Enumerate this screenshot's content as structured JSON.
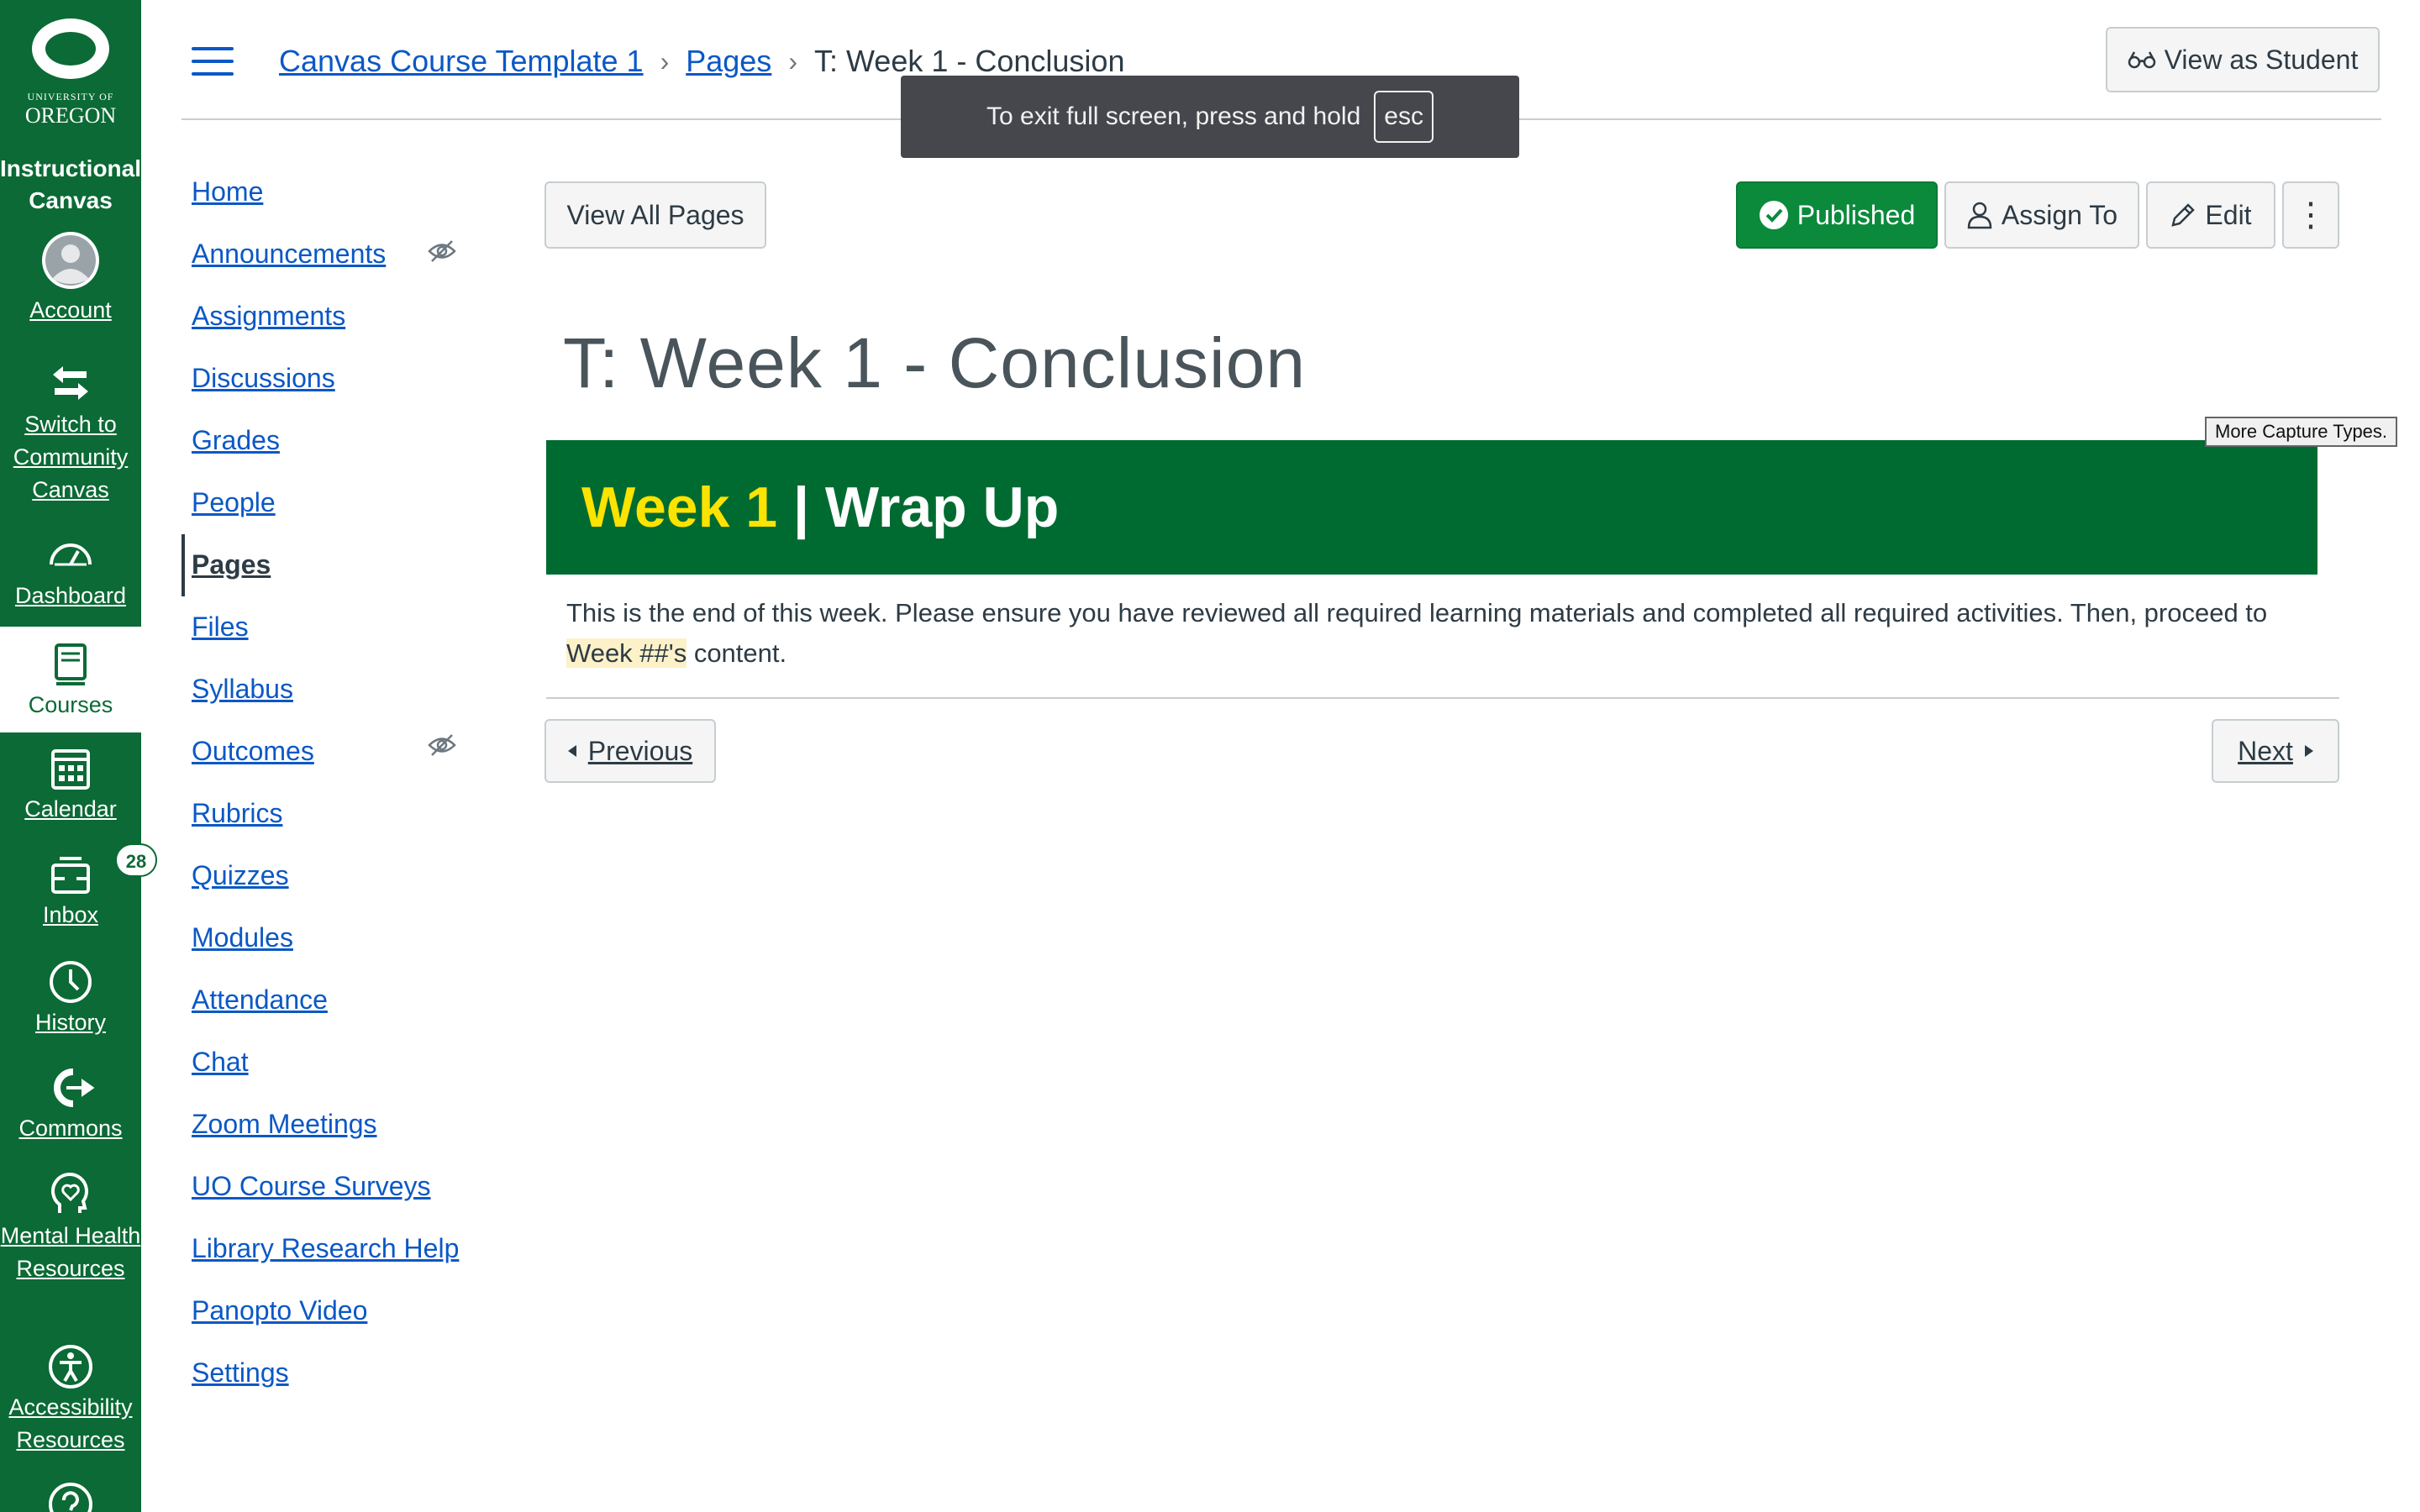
{
  "global_nav": {
    "logo": {
      "small": "UNIVERSITY OF",
      "big": "OREGON"
    },
    "institution": "Instructional Canvas",
    "items": [
      {
        "label": "Account",
        "icon": "avatar-icon"
      },
      {
        "label": "Switch to Community Canvas",
        "icon": "switch-arrows-icon"
      },
      {
        "label": "Dashboard",
        "icon": "dashboard-gauge-icon"
      },
      {
        "label": "Courses",
        "icon": "courses-book-icon",
        "active": true
      },
      {
        "label": "Calendar",
        "icon": "calendar-icon"
      },
      {
        "label": "Inbox",
        "icon": "inbox-icon",
        "badge": "28"
      },
      {
        "label": "History",
        "icon": "clock-icon"
      },
      {
        "label": "Commons",
        "icon": "commons-icon"
      },
      {
        "label": "Mental Health Resources",
        "icon": "heart-head-icon"
      },
      {
        "label": "Accessibility Resources",
        "icon": "accessibility-icon"
      }
    ]
  },
  "header": {
    "breadcrumb": [
      "Canvas Course Template 1",
      "Pages",
      "T: Week 1 - Conclusion"
    ],
    "view_as_student": "View as Student"
  },
  "fullscreen_toast": {
    "text": "To exit full screen, press and hold",
    "key": "esc"
  },
  "course_nav": [
    {
      "label": "Home"
    },
    {
      "label": "Announcements",
      "hidden": true
    },
    {
      "label": "Assignments"
    },
    {
      "label": "Discussions"
    },
    {
      "label": "Grades"
    },
    {
      "label": "People"
    },
    {
      "label": "Pages",
      "active": true
    },
    {
      "label": "Files"
    },
    {
      "label": "Syllabus"
    },
    {
      "label": "Outcomes",
      "hidden": true
    },
    {
      "label": "Rubrics"
    },
    {
      "label": "Quizzes"
    },
    {
      "label": "Modules"
    },
    {
      "label": "Attendance"
    },
    {
      "label": "Chat"
    },
    {
      "label": "Zoom Meetings"
    },
    {
      "label": "UO Course Surveys"
    },
    {
      "label": "Library Research Help"
    },
    {
      "label": "Panopto Video"
    },
    {
      "label": "Settings"
    }
  ],
  "toolbar": {
    "view_all_pages": "View All Pages",
    "published": "Published",
    "assign_to": "Assign To",
    "edit": "Edit",
    "more": "⋮"
  },
  "page": {
    "title": "T: Week 1 - Conclusion",
    "capture_tip": "More Capture Types.",
    "banner_week": "Week 1",
    "banner_rest": " | Wrap Up",
    "body_start": "This is the end of this week. Please ensure you have reviewed all required learning materials and completed all required activities. Then, proceed to ",
    "body_highlight": "Week ##'s",
    "body_end": " content.",
    "previous": "Previous",
    "next": "Next"
  },
  "colors": {
    "nav_green": "#0b6a35",
    "link_blue": "#0b58c5",
    "banner_green": "#006b31",
    "banner_yellow": "#fce300",
    "published_green": "#0b8a3c"
  }
}
